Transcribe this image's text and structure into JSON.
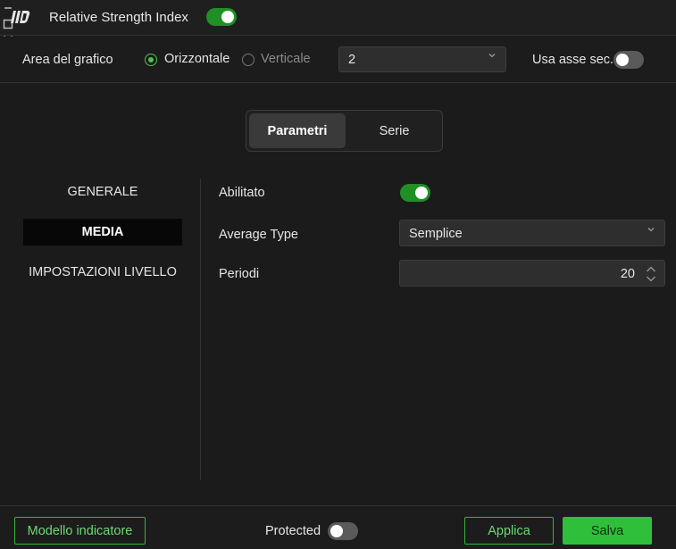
{
  "window": {
    "title": "Relative Strength Index",
    "enabled_toggle": true,
    "logo_icon": "app-logo-icon",
    "controls": [
      "minimize-icon",
      "maximize-icon",
      "close-icon"
    ]
  },
  "chart_area": {
    "label": "Area del grafico",
    "options": [
      {
        "label": "Orizzontale",
        "selected": true
      },
      {
        "label": "Verticale",
        "selected": false
      }
    ],
    "pane_value": "2",
    "secondary_axis_label": "Usa asse sec.",
    "secondary_axis_on": false
  },
  "tabs": [
    {
      "label": "Parametri",
      "active": true
    },
    {
      "label": "Serie",
      "active": false
    }
  ],
  "nav": [
    {
      "label": "GENERALE",
      "active": false
    },
    {
      "label": "MEDIA",
      "active": true
    },
    {
      "label": "IMPOSTAZIONI LIVELLO",
      "active": false
    }
  ],
  "form": {
    "enabled_label": "Abilitato",
    "enabled_on": true,
    "average_type_label": "Average Type",
    "average_type_value": "Semplice",
    "periods_label": "Periodi",
    "periods_value": "20"
  },
  "footer": {
    "template_button": "Modello indicatore",
    "protected_label": "Protected",
    "protected_on": false,
    "apply_button": "Applica",
    "save_button": "Salva"
  },
  "colors": {
    "accent": "#2fbf3a",
    "toggle_on": "#1f8f26",
    "background": "#1b1b1b"
  }
}
